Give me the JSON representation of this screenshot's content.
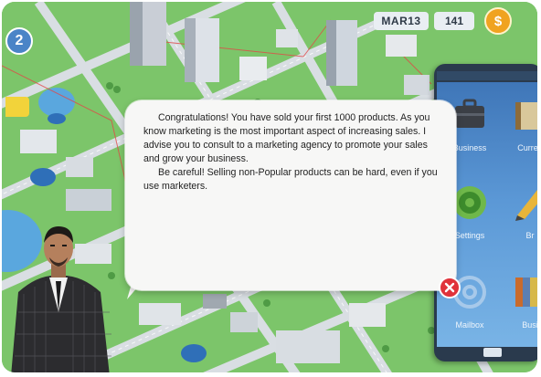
{
  "hud": {
    "level": "2",
    "date": "MAR13",
    "counter": "141",
    "coin_symbol": "$"
  },
  "dialog": {
    "paragraphs": [
      "Congratulations! You have sold your first 1000 products. As you know marketing is the most important aspect of increasing sales. I advise you to consult to a marketing agency to promote your sales and grow your business.",
      "Be careful! Selling non-Popular products can be hard, even if you use marketers."
    ]
  },
  "phone": {
    "header": "",
    "apps": [
      {
        "label": "Business",
        "icon": "briefcase-icon"
      },
      {
        "label": "Curren",
        "icon": "book-icon"
      },
      {
        "label": "Settings",
        "icon": "gear-icon"
      },
      {
        "label": "Br",
        "icon": "pencil-icon"
      },
      {
        "label": "Mailbox",
        "icon": "at-sign-icon"
      },
      {
        "label": "Busi",
        "icon": "folder-icon"
      }
    ]
  },
  "colors": {
    "grass": "#7cc56a",
    "road": "#d9dee3",
    "water": "#5aa7de",
    "phone_screen": "#5b98d6",
    "close_red": "#e0323a",
    "coin_orange": "#f0a320"
  }
}
